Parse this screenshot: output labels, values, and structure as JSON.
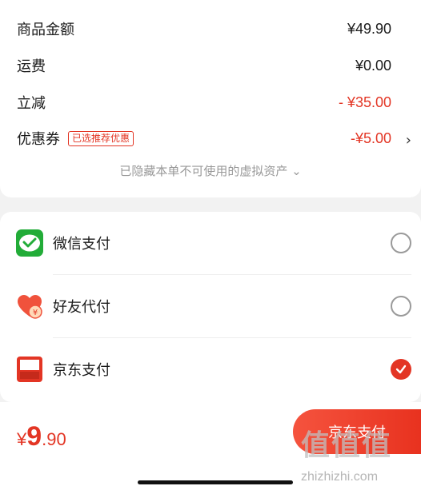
{
  "summary": {
    "goods_label": "商品金额",
    "goods_value": "¥49.90",
    "shipping_label": "运费",
    "shipping_value": "¥0.00",
    "discount_label": "立减",
    "discount_value": "- ¥35.00",
    "coupon_label": "优惠券",
    "coupon_tag": "已选推荐优惠",
    "coupon_value": "-¥5.00",
    "hidden_note": "已隐藏本单不可使用的虚拟资产 ⌄"
  },
  "payment_methods": [
    {
      "name": "微信支付",
      "selected": false,
      "icon": "wechat-pay-icon"
    },
    {
      "name": "好友代付",
      "selected": false,
      "icon": "friend-pay-icon"
    },
    {
      "name": "京东支付",
      "selected": true,
      "icon": "jd-pay-icon"
    }
  ],
  "bottom": {
    "currency": "¥",
    "price_int": "9",
    "price_dec": ".90",
    "pay_button": "京东支付"
  },
  "watermark": {
    "text": "值值值",
    "url": "zhizhizhi.com"
  },
  "colors": {
    "accent": "#e33524",
    "wechat": "#22ac38",
    "friend": "#f0523c"
  }
}
